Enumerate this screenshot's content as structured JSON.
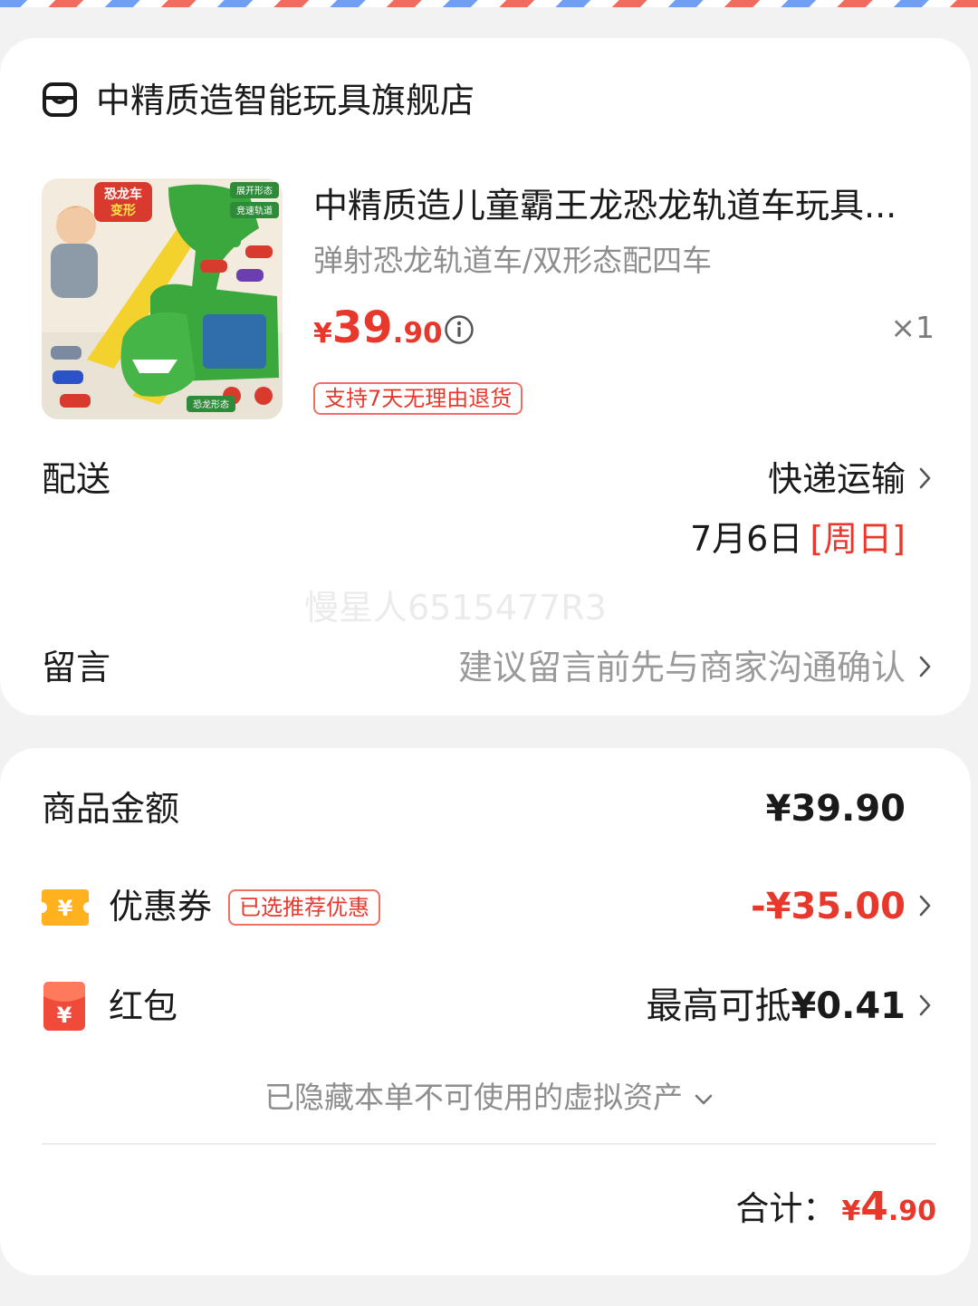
{
  "colors": {
    "accent": "#e8382c",
    "muted_text": "#8e8e8e",
    "background": "#f2f2f2"
  },
  "store": {
    "name": "中精质造智能玩具旗舰店",
    "icon": "store-icon"
  },
  "product": {
    "title": "中精质造儿童霸王龙恐龙轨道车玩具...",
    "sku": "弹射恐龙轨道车/双形态配四车",
    "price": {
      "currency": "¥",
      "integer": "39",
      "decimal": ".90"
    },
    "quantity": "×1",
    "return_tag": "支持7天无理由退货",
    "image_text": {
      "badge": "恐龙车变形",
      "tag1": "展开形态",
      "tag2": "竞速轨道",
      "tag3": "恐龙形态"
    }
  },
  "delivery": {
    "label": "配送",
    "value": "快递运输",
    "date": "7月6日",
    "weekday": "[周日]"
  },
  "watermark": "慢星人6515477R3",
  "message": {
    "label": "留言",
    "placeholder": "建议留言前先与商家沟通确认"
  },
  "summary": {
    "goods_amount": {
      "label": "商品金额",
      "value": "¥39.90"
    },
    "coupon": {
      "icon_glyph": "¥",
      "label": "优惠券",
      "tag": "已选推荐优惠",
      "value": "-¥35.00"
    },
    "red_packet": {
      "icon_glyph": "¥",
      "label": "红包",
      "prefix": "最高可抵",
      "value": "¥0.41"
    },
    "hidden_assets": "已隐藏本单不可使用的虚拟资产",
    "total": {
      "label": "合计：",
      "currency": "¥",
      "integer": "4",
      "decimal": ".90"
    }
  }
}
